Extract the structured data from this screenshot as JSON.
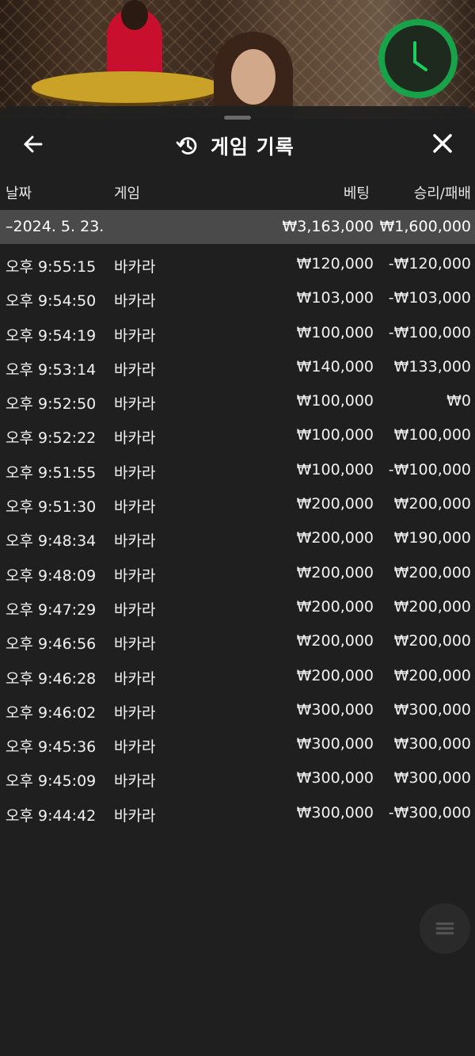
{
  "modal": {
    "title": "게임 기록",
    "columns": {
      "date": "날짜",
      "game": "게임",
      "bet": "베팅",
      "result": "승리/패배"
    },
    "date_group": {
      "date": "–2024. 5. 23.",
      "total_bet": "₩3,163,000",
      "total_result": "₩1,600,000"
    },
    "rows": [
      {
        "time": "오후 9:55:15",
        "game": "바카라",
        "bet": "₩120,000",
        "result": "-₩120,000"
      },
      {
        "time": "오후 9:54:50",
        "game": "바카라",
        "bet": "₩103,000",
        "result": "-₩103,000"
      },
      {
        "time": "오후 9:54:19",
        "game": "바카라",
        "bet": "₩100,000",
        "result": "-₩100,000"
      },
      {
        "time": "오후 9:53:14",
        "game": "바카라",
        "bet": "₩140,000",
        "result": "₩133,000"
      },
      {
        "time": "오후 9:52:50",
        "game": "바카라",
        "bet": "₩100,000",
        "result": "₩0"
      },
      {
        "time": "오후 9:52:22",
        "game": "바카라",
        "bet": "₩100,000",
        "result": "₩100,000"
      },
      {
        "time": "오후 9:51:55",
        "game": "바카라",
        "bet": "₩100,000",
        "result": "-₩100,000"
      },
      {
        "time": "오후 9:51:30",
        "game": "바카라",
        "bet": "₩200,000",
        "result": "₩200,000"
      },
      {
        "time": "오후 9:48:34",
        "game": "바카라",
        "bet": "₩200,000",
        "result": "₩190,000"
      },
      {
        "time": "오후 9:48:09",
        "game": "바카라",
        "bet": "₩200,000",
        "result": "₩200,000"
      },
      {
        "time": "오후 9:47:29",
        "game": "바카라",
        "bet": "₩200,000",
        "result": "₩200,000"
      },
      {
        "time": "오후 9:46:56",
        "game": "바카라",
        "bet": "₩200,000",
        "result": "₩200,000"
      },
      {
        "time": "오후 9:46:28",
        "game": "바카라",
        "bet": "₩200,000",
        "result": "₩200,000"
      },
      {
        "time": "오후 9:46:02",
        "game": "바카라",
        "bet": "₩300,000",
        "result": "₩300,000"
      },
      {
        "time": "오후 9:45:36",
        "game": "바카라",
        "bet": "₩300,000",
        "result": "₩300,000"
      },
      {
        "time": "오후 9:45:09",
        "game": "바카라",
        "bet": "₩300,000",
        "result": "₩300,000"
      },
      {
        "time": "오후 9:44:42",
        "game": "바카라",
        "bet": "₩300,000",
        "result": "-₩300,000"
      }
    ]
  },
  "icons": {
    "back": "back-arrow-icon",
    "history": "history-icon",
    "close": "close-icon",
    "timer": "timer-icon",
    "menu": "menu-icon"
  },
  "colors": {
    "timer_ring": "#18a34a",
    "date_row_bg": "#4a4a4a",
    "modal_bg": "#202020"
  }
}
